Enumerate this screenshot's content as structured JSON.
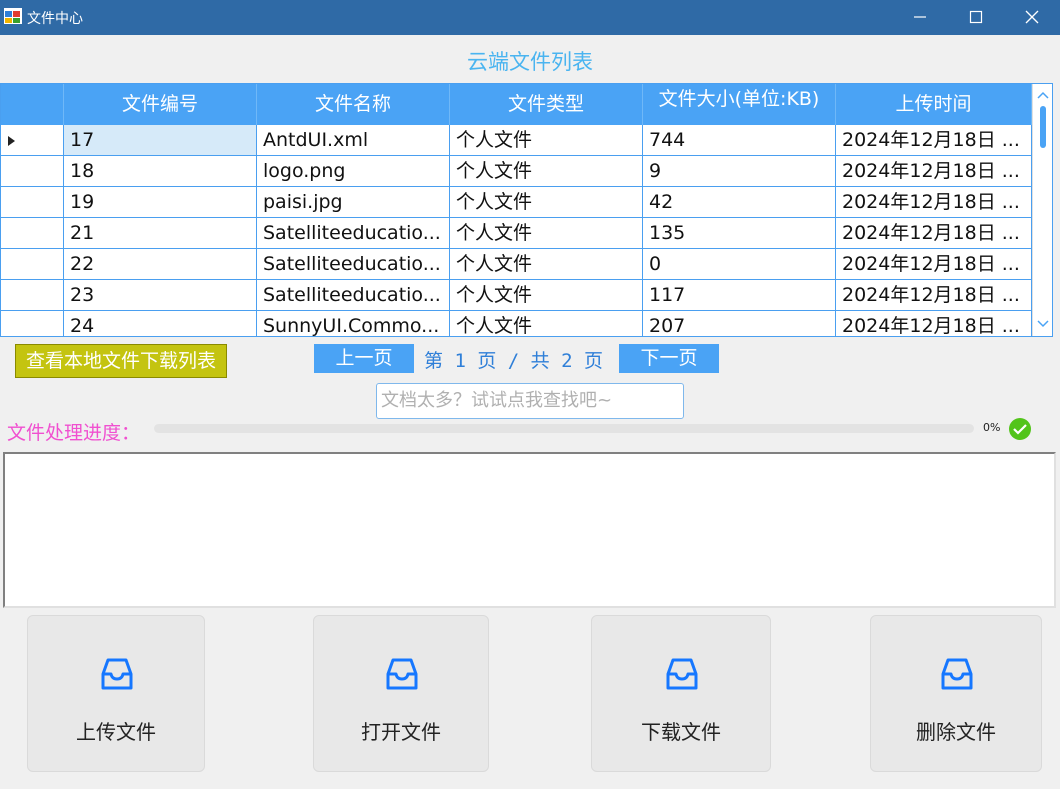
{
  "window": {
    "title": "文件中心"
  },
  "heading": "云端文件列表",
  "table": {
    "columns": [
      "文件编号",
      "文件名称",
      "文件类型",
      "文件大小(单位:KB)",
      "上传时间"
    ],
    "rows": [
      {
        "id": "17",
        "name": "AntdUI.xml",
        "type": "个人文件",
        "size": "744",
        "time": "2024年12月18日 ..."
      },
      {
        "id": "18",
        "name": "logo.png",
        "type": "个人文件",
        "size": "9",
        "time": "2024年12月18日 ..."
      },
      {
        "id": "19",
        "name": "paisi.jpg",
        "type": "个人文件",
        "size": "42",
        "time": "2024年12月18日 ..."
      },
      {
        "id": "21",
        "name": "Satelliteeducatio...",
        "type": "个人文件",
        "size": "135",
        "time": "2024年12月18日 ..."
      },
      {
        "id": "22",
        "name": "Satelliteeducatio...",
        "type": "个人文件",
        "size": "0",
        "time": "2024年12月18日 ..."
      },
      {
        "id": "23",
        "name": "Satelliteeducatio...",
        "type": "个人文件",
        "size": "117",
        "time": "2024年12月18日 ..."
      },
      {
        "id": "24",
        "name": "SunnyUI.Commo...",
        "type": "个人文件",
        "size": "207",
        "time": "2024年12月18日 ..."
      }
    ]
  },
  "local_download_button": "查看本地文件下载列表",
  "pagination": {
    "prev": "上一页",
    "status": "第 1 页 / 共 2 页",
    "next": "下一页"
  },
  "search": {
    "placeholder": "文档太多？试试点我查找吧~"
  },
  "progress": {
    "label": "文件处理进度：",
    "percent_text": "0%",
    "value": 0
  },
  "actions": {
    "upload": "上传文件",
    "open": "打开文件",
    "download": "下载文件",
    "delete": "删除文件"
  },
  "colors": {
    "accent": "#4aa3f5",
    "heading": "#4ab4f0",
    "progress_label": "#f050d0",
    "success": "#52c41a",
    "local_button": "#c4c410"
  }
}
